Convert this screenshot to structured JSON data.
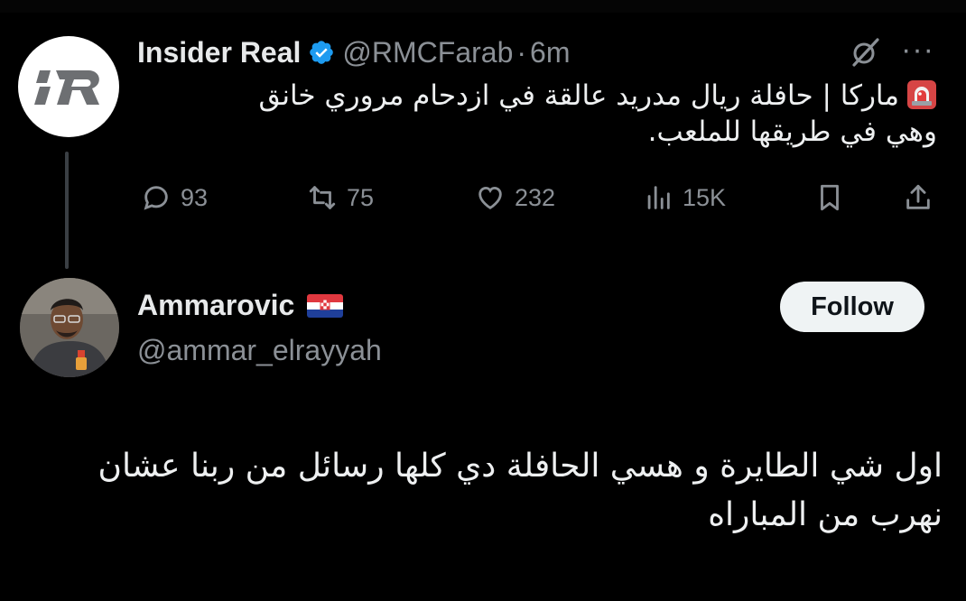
{
  "tweet": {
    "avatar_icon": "insider-real-logo",
    "author_name": "Insider Real",
    "verified_icon": "verified-badge-icon",
    "handle": "@RMCFarab",
    "separator": "·",
    "time": "6m",
    "grok_icon": "grok-icon",
    "more_label": "···",
    "siren_icon": "police-siren-emoji",
    "text_line1": "ماركا | حافلة ريال مدريد عالقة في ازدحام مروري خانق",
    "text_line2": "وهي في طريقها للملعب.",
    "actions": {
      "replies": "93",
      "retweets": "75",
      "likes": "232",
      "views": "15K"
    }
  },
  "reply": {
    "author_name": "Ammarovic",
    "flag_icon": "croatia-flag-emoji",
    "handle": "@ammar_elrayyah",
    "follow_label": "Follow",
    "text_line1": "اول شي الطايرة و هسي الحافلة دي كلها رسائل من ربنا عشان",
    "text_line2": "نهرب من المباراه"
  },
  "colors": {
    "background": "#000000",
    "text": "#e7e9ea",
    "muted": "#8b9096",
    "verified": "#1d9bf0",
    "follow_bg": "#eff3f4"
  }
}
